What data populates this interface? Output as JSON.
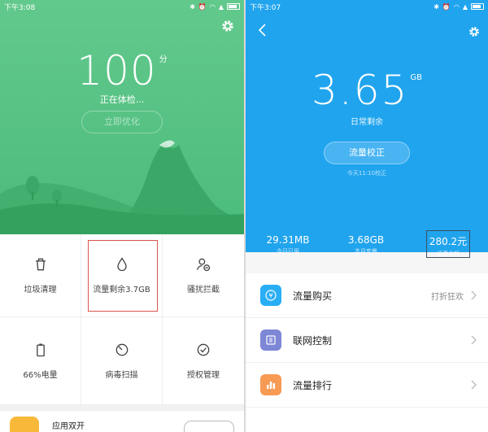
{
  "left": {
    "status": {
      "time": "下午3:08"
    },
    "score": "100",
    "score_unit": "分",
    "checking_text": "正在体检...",
    "optimize_label": "立即优化",
    "tools": [
      {
        "label": "垃圾清理",
        "icon": "trash-icon"
      },
      {
        "label": "流量剩余3.7GB",
        "icon": "water-drop-icon"
      },
      {
        "label": "骚扰拦截",
        "icon": "user-block-icon"
      },
      {
        "label": "66%电量",
        "icon": "battery-icon"
      },
      {
        "label": "病毒扫描",
        "icon": "scan-icon"
      },
      {
        "label": "授权管理",
        "icon": "check-circle-icon"
      }
    ],
    "app_dual": {
      "label": "应用双开"
    }
  },
  "right": {
    "status": {
      "time": "下午3:07"
    },
    "data_remaining": "3.65",
    "data_unit": "GB",
    "daily_left_label": "日常剩余",
    "calibrate_label": "流量校正",
    "calibrate_time": "今天11:10校正",
    "stats": [
      {
        "value": "29.31MB",
        "caption": "今日已用"
      },
      {
        "value": "3.68GB",
        "caption": "本月套餐"
      },
      {
        "value": "280.2元",
        "caption": "话费余额"
      }
    ],
    "list": [
      {
        "label": "流量购买",
        "promo": "打折狂欢",
        "icon_color": "#29aef5"
      },
      {
        "label": "联网控制",
        "promo": "",
        "icon_color": "#7e86d6"
      },
      {
        "label": "流量排行",
        "promo": "",
        "icon_color": "#f79a54"
      }
    ]
  },
  "colors": {
    "green": "#55c182",
    "blue": "#20a4ee",
    "highlight_red": "#d9534f"
  }
}
